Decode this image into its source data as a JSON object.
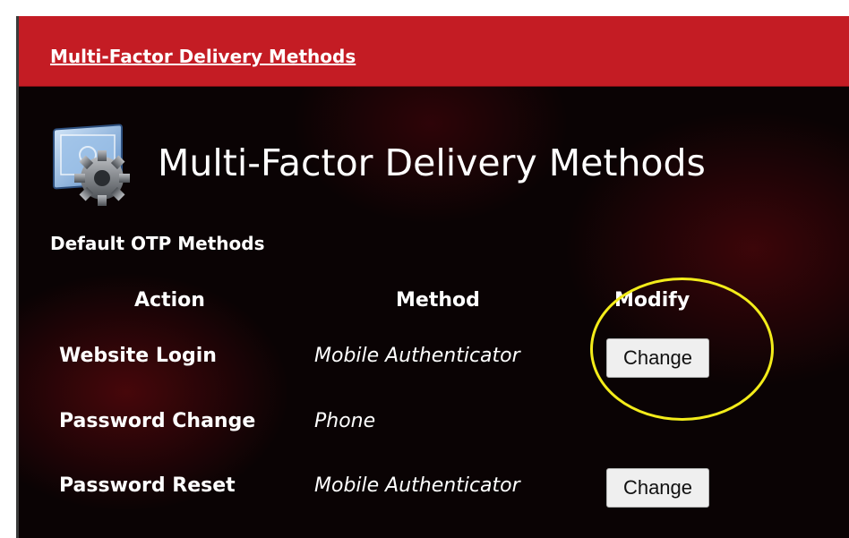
{
  "header": {
    "link_text": "Multi-Factor Delivery Methods"
  },
  "main": {
    "title": "Multi-Factor Delivery Methods",
    "section_heading": "Default OTP Methods",
    "columns": [
      "Action",
      "Method",
      "Modify"
    ],
    "rows": [
      {
        "action": "Website Login",
        "method": "Mobile Authenticator",
        "button": "Change"
      },
      {
        "action": "Password Change",
        "method": "Phone",
        "button": ""
      },
      {
        "action": "Password Reset",
        "method": "Mobile Authenticator",
        "button": "Change"
      }
    ]
  },
  "icons": {
    "app_icon": "settings-window-gear-icon"
  },
  "colors": {
    "header_red": "#c41c24",
    "panel_bg": "#0a0304",
    "highlight": "#f3ec1a"
  }
}
